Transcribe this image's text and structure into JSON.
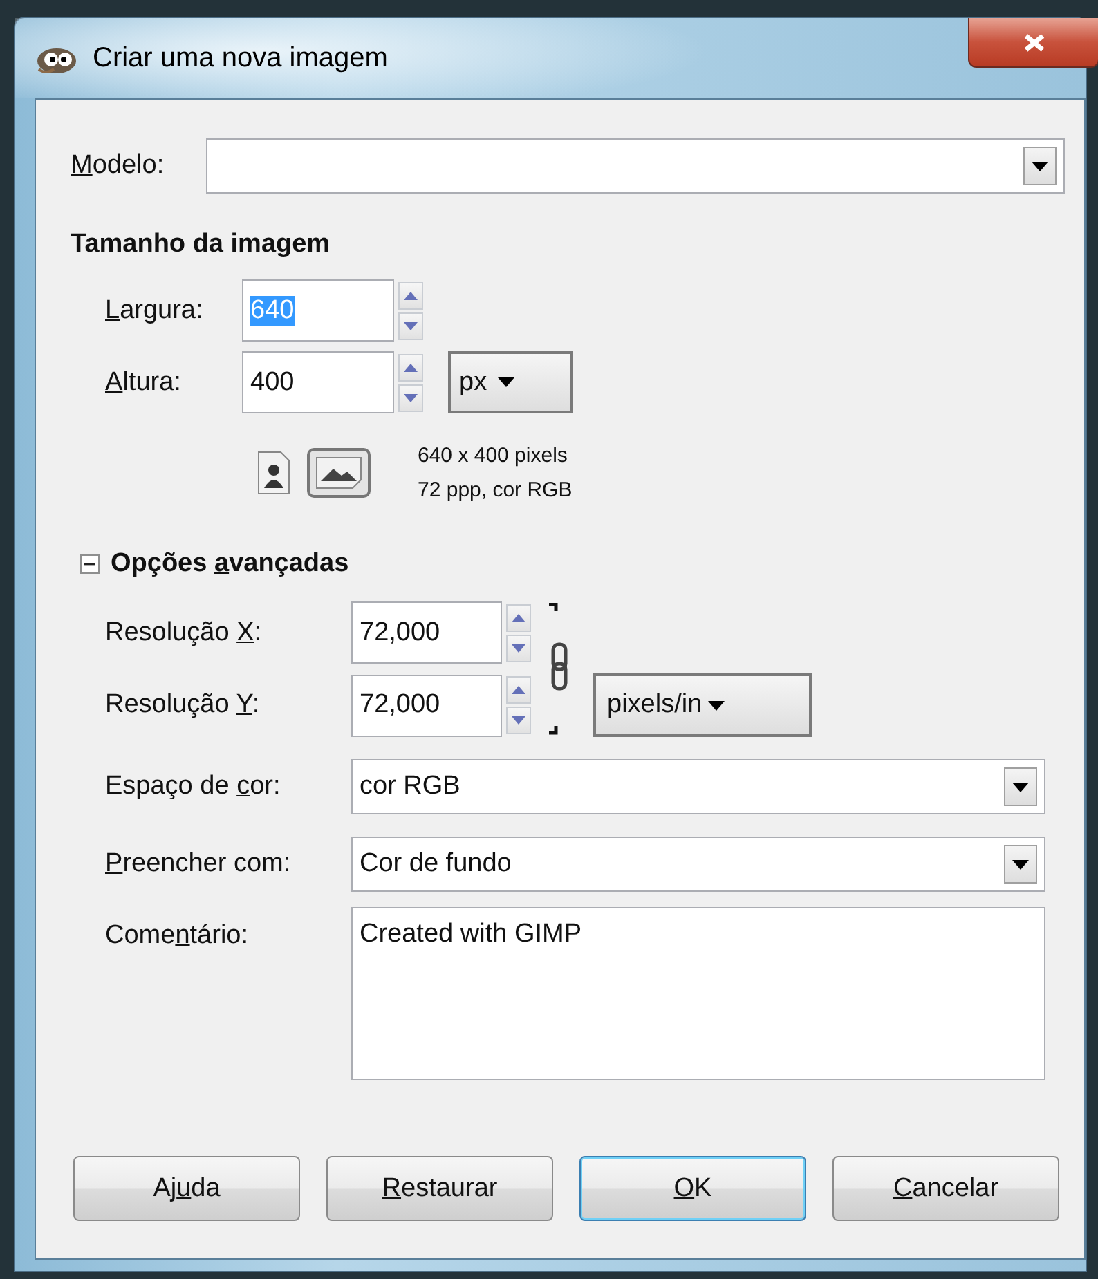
{
  "window": {
    "title": "Criar uma nova imagem"
  },
  "template": {
    "label": {
      "key": "M",
      "after": "odelo:"
    }
  },
  "image_size": {
    "heading": "Tamanho da imagem",
    "width": {
      "label": {
        "key": "L",
        "after": "argura:"
      },
      "value": "640",
      "selected": true
    },
    "height": {
      "label": {
        "key": "A",
        "after": "ltura:"
      },
      "value": "400",
      "selected": false
    },
    "unit": "px",
    "orientation": [
      {
        "kind": "portrait",
        "selected": false
      },
      {
        "kind": "landscape",
        "selected": true
      }
    ],
    "info": [
      "640 x 400 pixels",
      "72 ppp, cor RGB"
    ]
  },
  "advanced": {
    "label": {
      "before": "Opções ",
      "key": "a",
      "after": "vançadas"
    },
    "expanded": true,
    "x_resolution": {
      "label": {
        "before": "Resolução ",
        "key": "X",
        "after": ":"
      },
      "value": "72,000"
    },
    "y_resolution": {
      "label": {
        "before": "Resolução ",
        "key": "Y",
        "after": ":"
      },
      "value": "72,000"
    },
    "chained": true,
    "resolution_unit": "pixels/in",
    "color_space": {
      "label": {
        "before": "Espaço de ",
        "key": "c",
        "after": "or:"
      },
      "value": "cor RGB"
    },
    "fill": {
      "label": {
        "key": "P",
        "after": "reencher com:"
      },
      "value": "Cor de fundo"
    },
    "comment": {
      "label": {
        "before": "Come",
        "key": "n",
        "after": "tário:"
      },
      "value": "Created with GIMP"
    }
  },
  "buttons": [
    {
      "label": {
        "before": "Aj",
        "key": "u",
        "after": "da"
      },
      "default": false
    },
    {
      "label": {
        "key": "R",
        "after": "estaurar"
      },
      "default": false
    },
    {
      "label": {
        "key": "O",
        "after": "K"
      },
      "default": true
    },
    {
      "label": {
        "key": "C",
        "after": "ancelar"
      },
      "default": false
    }
  ]
}
